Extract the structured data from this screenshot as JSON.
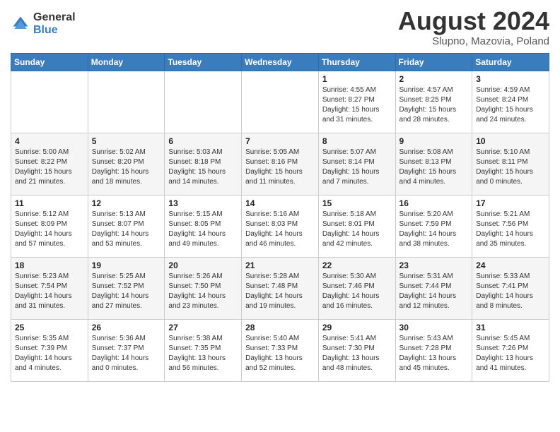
{
  "header": {
    "logo_general": "General",
    "logo_blue": "Blue",
    "month_title": "August 2024",
    "location": "Slupno, Mazovia, Poland"
  },
  "weekdays": [
    "Sunday",
    "Monday",
    "Tuesday",
    "Wednesday",
    "Thursday",
    "Friday",
    "Saturday"
  ],
  "weeks": [
    [
      {
        "date": "",
        "info": ""
      },
      {
        "date": "",
        "info": ""
      },
      {
        "date": "",
        "info": ""
      },
      {
        "date": "",
        "info": ""
      },
      {
        "date": "1",
        "info": "Sunrise: 4:55 AM\nSunset: 8:27 PM\nDaylight: 15 hours\nand 31 minutes."
      },
      {
        "date": "2",
        "info": "Sunrise: 4:57 AM\nSunset: 8:25 PM\nDaylight: 15 hours\nand 28 minutes."
      },
      {
        "date": "3",
        "info": "Sunrise: 4:59 AM\nSunset: 8:24 PM\nDaylight: 15 hours\nand 24 minutes."
      }
    ],
    [
      {
        "date": "4",
        "info": "Sunrise: 5:00 AM\nSunset: 8:22 PM\nDaylight: 15 hours\nand 21 minutes."
      },
      {
        "date": "5",
        "info": "Sunrise: 5:02 AM\nSunset: 8:20 PM\nDaylight: 15 hours\nand 18 minutes."
      },
      {
        "date": "6",
        "info": "Sunrise: 5:03 AM\nSunset: 8:18 PM\nDaylight: 15 hours\nand 14 minutes."
      },
      {
        "date": "7",
        "info": "Sunrise: 5:05 AM\nSunset: 8:16 PM\nDaylight: 15 hours\nand 11 minutes."
      },
      {
        "date": "8",
        "info": "Sunrise: 5:07 AM\nSunset: 8:14 PM\nDaylight: 15 hours\nand 7 minutes."
      },
      {
        "date": "9",
        "info": "Sunrise: 5:08 AM\nSunset: 8:13 PM\nDaylight: 15 hours\nand 4 minutes."
      },
      {
        "date": "10",
        "info": "Sunrise: 5:10 AM\nSunset: 8:11 PM\nDaylight: 15 hours\nand 0 minutes."
      }
    ],
    [
      {
        "date": "11",
        "info": "Sunrise: 5:12 AM\nSunset: 8:09 PM\nDaylight: 14 hours\nand 57 minutes."
      },
      {
        "date": "12",
        "info": "Sunrise: 5:13 AM\nSunset: 8:07 PM\nDaylight: 14 hours\nand 53 minutes."
      },
      {
        "date": "13",
        "info": "Sunrise: 5:15 AM\nSunset: 8:05 PM\nDaylight: 14 hours\nand 49 minutes."
      },
      {
        "date": "14",
        "info": "Sunrise: 5:16 AM\nSunset: 8:03 PM\nDaylight: 14 hours\nand 46 minutes."
      },
      {
        "date": "15",
        "info": "Sunrise: 5:18 AM\nSunset: 8:01 PM\nDaylight: 14 hours\nand 42 minutes."
      },
      {
        "date": "16",
        "info": "Sunrise: 5:20 AM\nSunset: 7:59 PM\nDaylight: 14 hours\nand 38 minutes."
      },
      {
        "date": "17",
        "info": "Sunrise: 5:21 AM\nSunset: 7:56 PM\nDaylight: 14 hours\nand 35 minutes."
      }
    ],
    [
      {
        "date": "18",
        "info": "Sunrise: 5:23 AM\nSunset: 7:54 PM\nDaylight: 14 hours\nand 31 minutes."
      },
      {
        "date": "19",
        "info": "Sunrise: 5:25 AM\nSunset: 7:52 PM\nDaylight: 14 hours\nand 27 minutes."
      },
      {
        "date": "20",
        "info": "Sunrise: 5:26 AM\nSunset: 7:50 PM\nDaylight: 14 hours\nand 23 minutes."
      },
      {
        "date": "21",
        "info": "Sunrise: 5:28 AM\nSunset: 7:48 PM\nDaylight: 14 hours\nand 19 minutes."
      },
      {
        "date": "22",
        "info": "Sunrise: 5:30 AM\nSunset: 7:46 PM\nDaylight: 14 hours\nand 16 minutes."
      },
      {
        "date": "23",
        "info": "Sunrise: 5:31 AM\nSunset: 7:44 PM\nDaylight: 14 hours\nand 12 minutes."
      },
      {
        "date": "24",
        "info": "Sunrise: 5:33 AM\nSunset: 7:41 PM\nDaylight: 14 hours\nand 8 minutes."
      }
    ],
    [
      {
        "date": "25",
        "info": "Sunrise: 5:35 AM\nSunset: 7:39 PM\nDaylight: 14 hours\nand 4 minutes."
      },
      {
        "date": "26",
        "info": "Sunrise: 5:36 AM\nSunset: 7:37 PM\nDaylight: 14 hours\nand 0 minutes."
      },
      {
        "date": "27",
        "info": "Sunrise: 5:38 AM\nSunset: 7:35 PM\nDaylight: 13 hours\nand 56 minutes."
      },
      {
        "date": "28",
        "info": "Sunrise: 5:40 AM\nSunset: 7:33 PM\nDaylight: 13 hours\nand 52 minutes."
      },
      {
        "date": "29",
        "info": "Sunrise: 5:41 AM\nSunset: 7:30 PM\nDaylight: 13 hours\nand 48 minutes."
      },
      {
        "date": "30",
        "info": "Sunrise: 5:43 AM\nSunset: 7:28 PM\nDaylight: 13 hours\nand 45 minutes."
      },
      {
        "date": "31",
        "info": "Sunrise: 5:45 AM\nSunset: 7:26 PM\nDaylight: 13 hours\nand 41 minutes."
      }
    ]
  ]
}
